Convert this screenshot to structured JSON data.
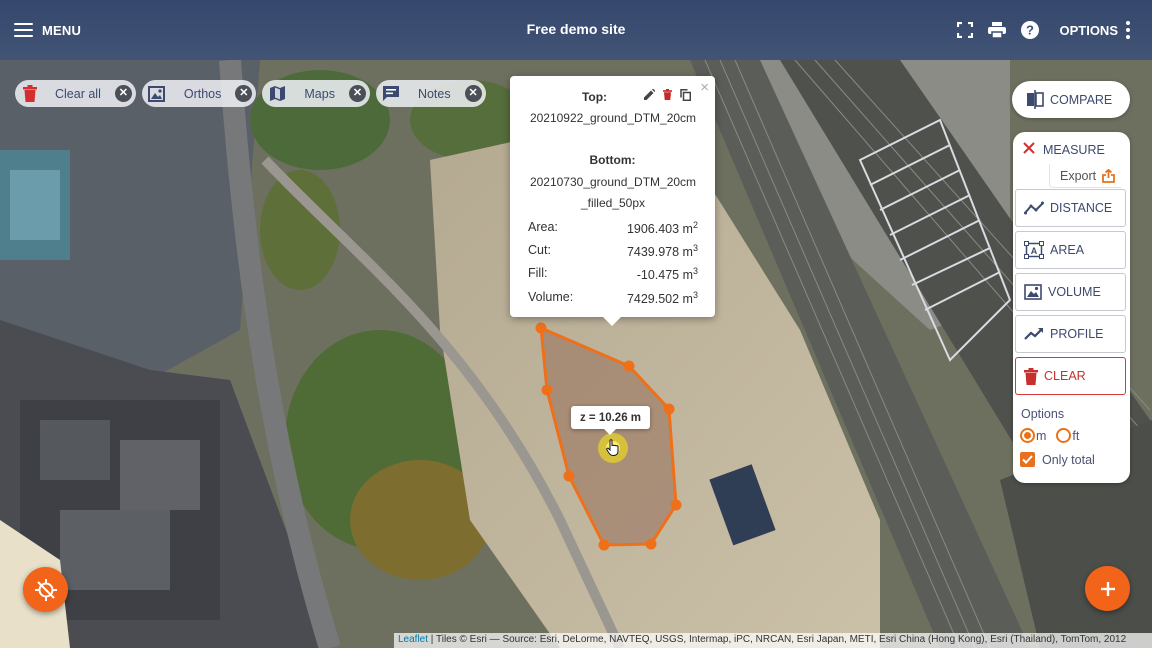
{
  "app": {
    "menu_label": "MENU",
    "site_title": "Free demo site",
    "options_label": "OPTIONS"
  },
  "toolbar_icons": [
    "fullscreen-icon",
    "print-icon",
    "help-icon",
    "more-vertical-icon"
  ],
  "chips": [
    {
      "label": "Clear all",
      "icon": "trash-icon"
    },
    {
      "label": "Orthos",
      "icon": "image-icon"
    },
    {
      "label": "Maps",
      "icon": "map-icon"
    },
    {
      "label": "Notes",
      "icon": "note-icon"
    }
  ],
  "popup": {
    "top_title": "Top:",
    "top_file": "20210922_ground_DTM_20cm",
    "bottom_title": "Bottom:",
    "bottom_file": "20210730_ground_DTM_20cm_filled_50px",
    "stats": [
      {
        "label": "Area:",
        "value": "1906.403 m",
        "unit_power": "2"
      },
      {
        "label": "Cut:",
        "value": "7439.978 m",
        "unit_power": "3"
      },
      {
        "label": "Fill:",
        "value": "-10.475 m",
        "unit_power": "3"
      },
      {
        "label": "Volume:",
        "value": "7429.502 m",
        "unit_power": "3"
      }
    ],
    "close_symbol": "×"
  },
  "z_label": "z = 10.26 m",
  "compare_label": "COMPARE",
  "measure": {
    "title": "MEASURE",
    "export_label": "Export",
    "tools": [
      {
        "label": "DISTANCE",
        "icon": "distance-icon"
      },
      {
        "label": "AREA",
        "icon": "area-icon"
      },
      {
        "label": "VOLUME",
        "icon": "volume-icon"
      },
      {
        "label": "PROFILE",
        "icon": "profile-icon"
      },
      {
        "label": "CLEAR",
        "icon": "trash-icon"
      }
    ],
    "options_title": "Options",
    "unit_m": "m",
    "unit_ft": "ft",
    "selected_unit": "m",
    "only_total_label": "Only total",
    "only_total_checked": true
  },
  "colors": {
    "accent": "#f26419",
    "polygon_stroke": "#f0701a",
    "topbar": "#30446e",
    "clear_red": "#c8302e"
  },
  "attribution": {
    "leaflet": "Leaflet",
    "text": " | Tiles © Esri — Source: Esri, DeLorme, NAVTEQ, USGS, Intermap, iPC, NRCAN, Esri Japan, METI, Esri China (Hong Kong), Esri (Thailand), TomTom, 2012"
  }
}
